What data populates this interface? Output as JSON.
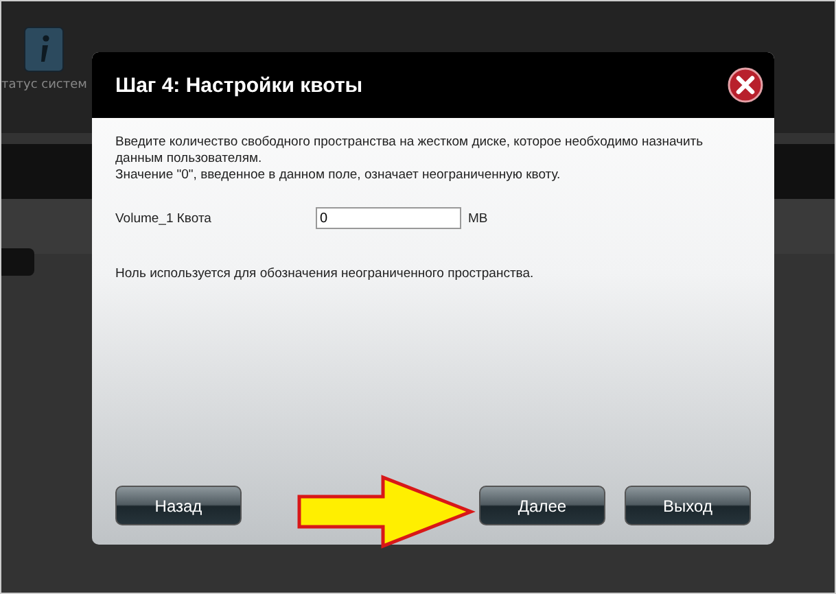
{
  "background": {
    "app_label": "татус систем"
  },
  "dialog": {
    "title": "Шаг 4: Настройки квоты",
    "intro": [
      "Введите количество свободного пространства на жестком диске, которое необходимо назначить данным пользователям.",
      "Значение \"0\", введенное в данном поле, означает неограниченную квоту."
    ],
    "quota_field": {
      "label": "Volume_1 Квота",
      "value": "0",
      "unit": "MB"
    },
    "note": "Ноль используется для обозначения неограниченного пространства.",
    "buttons": [
      "Назад",
      "Далее",
      "Выход"
    ]
  }
}
